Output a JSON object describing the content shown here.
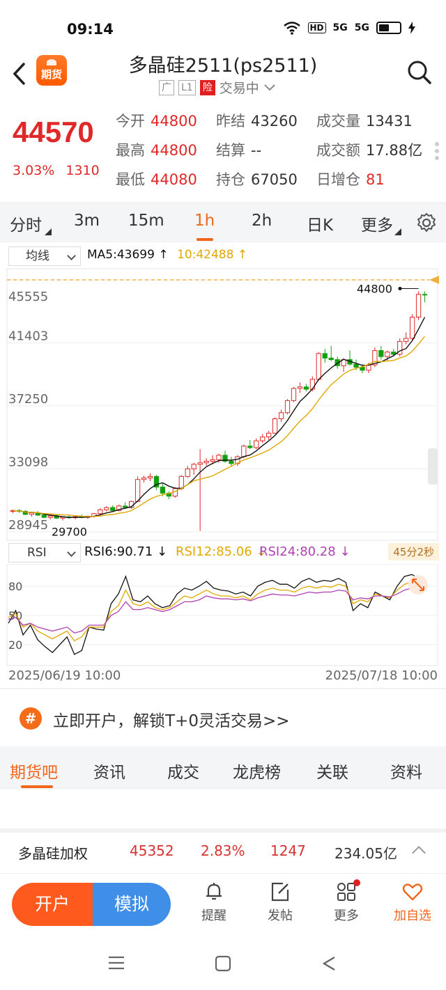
{
  "status_bar": {
    "time": "09:14",
    "icons": [
      "wifi-icon",
      "hd-icon",
      "5g-signal-icon",
      "5g-signal-icon",
      "battery-icon",
      "charging-icon"
    ],
    "hd": "HD",
    "net1": "5G",
    "net2": "5G"
  },
  "header": {
    "title": "多晶硅2511(ps2511)",
    "app_badge": "期货",
    "tags": [
      "广",
      "L1",
      "险"
    ],
    "status": "交易中"
  },
  "quote": {
    "price": "44570",
    "change_pct": "3.03%",
    "change_abs": "1310",
    "fields": [
      [
        {
          "label": "今开",
          "value": "44800"
        },
        {
          "label": "昨结",
          "value": "43260"
        },
        {
          "label": "成交量",
          "value": "13431"
        }
      ],
      [
        {
          "label": "最高",
          "value": "44800"
        },
        {
          "label": "结算",
          "value": "--"
        },
        {
          "label": "成交额",
          "value": "17.88亿"
        }
      ],
      [
        {
          "label": "最低",
          "value": "44080"
        },
        {
          "label": "持仓",
          "value": "67050"
        },
        {
          "label": "日增仓",
          "value": "81"
        }
      ]
    ]
  },
  "period_tabs": [
    "分时",
    "3m",
    "15m",
    "1h",
    "2h",
    "日K",
    "更多"
  ],
  "active_period": "1h",
  "ma_bar": {
    "selector": "均线",
    "ma5": "MA5:43699",
    "ma10": "10:42488"
  },
  "rsi_bar": {
    "selector": "RSI",
    "rsi6": "RSI6:90.71",
    "rsi12": "RSI12:85.06",
    "rsi24": "RSI24:80.28",
    "timer": "45分2秒"
  },
  "colors": {
    "up": "#e02828",
    "down": "#12a010",
    "ma5": "#111111",
    "ma10": "#e0a800",
    "rsi24": "#b040b0",
    "accent": "#f0661b"
  },
  "chart_data": [
    {
      "type": "candlestick",
      "ylim": [
        28945,
        45555
      ],
      "y_tick_labels": [
        "45555",
        "41403",
        "37250",
        "33098",
        "28945"
      ],
      "annotations": {
        "high_label": "44800",
        "low_label": "29700"
      },
      "last_price_marker": 45555,
      "candles_ohlc": [
        [
          30300,
          30420,
          30180,
          30350
        ],
        [
          30350,
          30450,
          30200,
          30300
        ],
        [
          30300,
          30380,
          30050,
          30100
        ],
        [
          30100,
          30250,
          29950,
          30200
        ],
        [
          30200,
          30300,
          30000,
          30050
        ],
        [
          30050,
          30150,
          29850,
          29900
        ],
        [
          29900,
          30050,
          29760,
          30000
        ],
        [
          30000,
          30120,
          29800,
          29850
        ],
        [
          29850,
          29980,
          29700,
          29920
        ],
        [
          29920,
          30050,
          29820,
          29880
        ],
        [
          29880,
          30000,
          29780,
          29950
        ],
        [
          29950,
          30100,
          29850,
          29900
        ],
        [
          29900,
          30020,
          29800,
          29980
        ],
        [
          29980,
          30200,
          29900,
          30150
        ],
        [
          30150,
          30500,
          30050,
          30400
        ],
        [
          30400,
          30650,
          30300,
          30550
        ],
        [
          30550,
          30700,
          30250,
          30350
        ],
        [
          30350,
          30750,
          30300,
          30650
        ],
        [
          30650,
          30900,
          30500,
          30550
        ],
        [
          30550,
          31000,
          30450,
          30950
        ],
        [
          30950,
          32600,
          30900,
          32400
        ],
        [
          32400,
          32650,
          32200,
          32500
        ],
        [
          32500,
          32800,
          32300,
          32600
        ],
        [
          32600,
          32700,
          31700,
          31900
        ],
        [
          31900,
          32200,
          31300,
          31500
        ],
        [
          31500,
          31600,
          31100,
          31300
        ],
        [
          31300,
          31900,
          31200,
          31800
        ],
        [
          31800,
          32700,
          31700,
          32600
        ],
        [
          32600,
          33300,
          32500,
          33100
        ],
        [
          33100,
          33500,
          32700,
          33400
        ],
        [
          33400,
          34400,
          29000,
          33500
        ],
        [
          33500,
          33800,
          33300,
          33600
        ],
        [
          33600,
          34000,
          33400,
          33700
        ],
        [
          33700,
          34100,
          33500,
          34000
        ],
        [
          34000,
          34300,
          33500,
          33600
        ],
        [
          33600,
          33900,
          33300,
          33450
        ],
        [
          33450,
          34000,
          33300,
          33900
        ],
        [
          33900,
          34700,
          33800,
          34600
        ],
        [
          34600,
          35000,
          34400,
          34500
        ],
        [
          34500,
          35100,
          34400,
          34950
        ],
        [
          34950,
          35400,
          34800,
          35200
        ],
        [
          35200,
          35600,
          35000,
          35450
        ],
        [
          35450,
          36500,
          35400,
          36400
        ],
        [
          36400,
          37000,
          36200,
          36800
        ],
        [
          36800,
          37700,
          36700,
          37600
        ],
        [
          37600,
          38500,
          37500,
          38400
        ],
        [
          38400,
          38800,
          38100,
          38500
        ],
        [
          38500,
          38700,
          38200,
          38350
        ],
        [
          38350,
          39200,
          38200,
          39000
        ],
        [
          39000,
          40800,
          38900,
          40700
        ],
        [
          40700,
          41000,
          40100,
          40400
        ],
        [
          40400,
          41200,
          40200,
          40300
        ],
        [
          40300,
          40500,
          39700,
          39900
        ],
        [
          39900,
          40400,
          39500,
          40300
        ],
        [
          40300,
          40900,
          39900,
          40000
        ],
        [
          40000,
          40300,
          39600,
          39800
        ],
        [
          39800,
          40000,
          39400,
          39600
        ],
        [
          39600,
          40100,
          39400,
          39950
        ],
        [
          39950,
          41100,
          39800,
          40900
        ],
        [
          40900,
          41200,
          40300,
          40500
        ],
        [
          40500,
          40900,
          40200,
          40800
        ],
        [
          40800,
          41000,
          40500,
          40650
        ],
        [
          40650,
          41700,
          40500,
          41500
        ],
        [
          41500,
          42100,
          41300,
          41700
        ],
        [
          41700,
          43300,
          41600,
          43100
        ],
        [
          43100,
          44800,
          42900,
          44600
        ],
        [
          44600,
          44800,
          44080,
          44570
        ]
      ]
    },
    {
      "type": "line",
      "title": "RSI",
      "y_tick_labels": [
        "80",
        "50",
        "20"
      ],
      "ylim": [
        0,
        100
      ],
      "series": [
        {
          "name": "RSI6",
          "values": [
            42,
            55,
            30,
            40,
            25,
            18,
            12,
            20,
            28,
            10,
            14,
            38,
            36,
            35,
            62,
            72,
            90,
            66,
            64,
            70,
            62,
            58,
            60,
            72,
            78,
            76,
            80,
            85,
            78,
            76,
            75,
            72,
            74,
            70,
            80,
            84,
            86,
            82,
            82,
            78,
            85,
            88,
            84,
            86,
            85,
            88,
            84,
            55,
            62,
            58,
            74,
            70,
            66,
            80,
            90,
            92,
            88,
            86
          ]
        },
        {
          "name": "RSI12",
          "values": [
            48,
            52,
            38,
            42,
            34,
            30,
            26,
            30,
            34,
            24,
            28,
            38,
            38,
            38,
            54,
            60,
            76,
            62,
            60,
            64,
            58,
            56,
            58,
            64,
            70,
            68,
            72,
            76,
            72,
            70,
            70,
            68,
            70,
            66,
            72,
            76,
            78,
            76,
            76,
            74,
            78,
            80,
            78,
            80,
            79,
            82,
            80,
            62,
            66,
            64,
            72,
            70,
            68,
            76,
            82,
            84,
            82,
            80
          ]
        },
        {
          "name": "RSI24",
          "values": [
            46,
            48,
            40,
            42,
            38,
            36,
            34,
            36,
            38,
            32,
            34,
            40,
            40,
            40,
            50,
            54,
            64,
            56,
            56,
            58,
            56,
            54,
            56,
            60,
            64,
            64,
            66,
            70,
            68,
            67,
            67,
            66,
            67,
            65,
            68,
            70,
            72,
            71,
            71,
            70,
            72,
            74,
            73,
            74,
            74,
            76,
            75,
            66,
            68,
            67,
            70,
            70,
            69,
            72,
            76,
            78,
            77,
            76
          ]
        }
      ]
    }
  ],
  "date_range": {
    "start": "2025/06/19 10:00",
    "end": "2025/07/18 10:00"
  },
  "promo": {
    "icon": "#",
    "text": "立即开户，解锁T+0灵活交易>>"
  },
  "info_tabs": [
    "期货吧",
    "资讯",
    "成交",
    "龙虎榜",
    "关联",
    "资料"
  ],
  "active_info_tab": "期货吧",
  "related": {
    "name": "多晶硅加权",
    "price": "45352",
    "pct": "2.83%",
    "change": "1247",
    "amount": "234.05亿"
  },
  "bottom_bar": {
    "open_account": "开户",
    "simulate": "模拟",
    "nav": [
      {
        "label": "提醒",
        "icon": "bell-icon"
      },
      {
        "label": "发帖",
        "icon": "compose-icon"
      },
      {
        "label": "更多",
        "icon": "grid-icon"
      },
      {
        "label": "加自选",
        "icon": "heart-icon"
      }
    ]
  }
}
